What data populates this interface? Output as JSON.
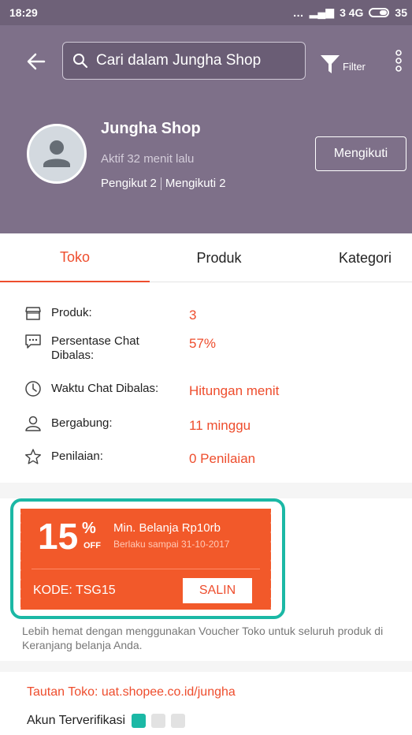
{
  "statusbar": {
    "time": "18:29",
    "network": "3 4G",
    "battery": "35"
  },
  "header": {
    "search_placeholder": "Cari dalam Jungha Shop",
    "filter_label": "Filter"
  },
  "shop": {
    "name": "Jungha Shop",
    "active": "Aktif 32 menit lalu",
    "followers": "Pengikut 2",
    "following": "Mengikuti 2",
    "follow_button": "Mengikuti"
  },
  "tabs": [
    {
      "label": "Toko"
    },
    {
      "label": "Produk"
    },
    {
      "label": "Kategori"
    }
  ],
  "stats": [
    {
      "icon": "store-icon",
      "label": "Produk:",
      "value": "3"
    },
    {
      "icon": "chat-icon",
      "label": "Persentase Chat Dibalas:",
      "value": "57%"
    },
    {
      "icon": "clock-icon",
      "label": "Waktu Chat Dibalas:",
      "value": "Hitungan menit"
    },
    {
      "icon": "user-icon",
      "label": "Bergabung:",
      "value": "11 minggu"
    },
    {
      "icon": "star-icon",
      "label": "Penilaian:",
      "value": "0 Penilaian"
    }
  ],
  "voucher": {
    "percent": "15",
    "percent_sign": "%",
    "off": "OFF",
    "min_spend": "Min. Belanja Rp10rb",
    "valid_until": "Berlaku sampai 31-10-2017",
    "code": "KODE: TSG15",
    "copy_button": "SALIN",
    "note": "Lebih hemat dengan menggunakan Voucher Toko untuk seluruh produk di Keranjang belanja Anda."
  },
  "footer": {
    "shop_link": "Tautan Toko: uat.shopee.co.id/jungha",
    "verified_label": "Akun Terverifikasi"
  },
  "colors": {
    "header": "#7e7089",
    "accent": "#ee4d2d",
    "voucher": "#f2592a",
    "highlight": "#1bb8a5"
  }
}
